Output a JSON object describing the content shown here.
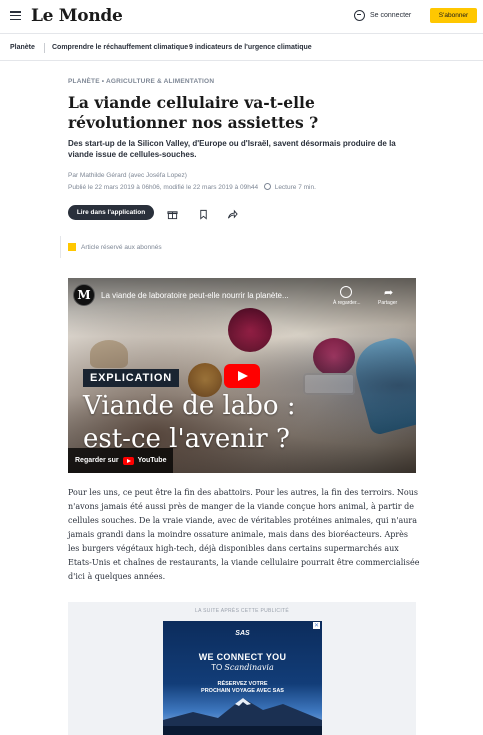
{
  "header": {
    "logo": "Le Monde",
    "login_label": "Se connecter",
    "subscribe_label": "S'abonner"
  },
  "nav": {
    "items": [
      "Planète",
      "Comprendre le réchauffement climatique",
      "9 indicateurs de l'urgence climatique"
    ]
  },
  "article": {
    "kicker": "PLANÈTE  •  AGRICULTURE & ALIMENTATION",
    "title": "La viande cellulaire va-t-elle révolutionner nos assiettes ?",
    "lead": "Des start-up de la Silicon Valley, d'Europe ou d'Israël, savent désormais produire de la viande issue de cellules-souches.",
    "author": "Par Mathilde Gérard (avec Joséfa Lopez)",
    "dates": "Publié le 22 mars 2019 à 06h06, modifié le 22 mars 2019 à 09h44",
    "reading_time": "Lecture 7 min.",
    "app_button": "Lire dans l'application",
    "reserved": "Article réservé aux abonnés",
    "body": "Pour les uns, ce peut être la fin des abattoirs. Pour les autres, la fin des terroirs. Nous n'avons jamais été aussi près de manger de la viande conçue hors animal, à partir de cellules souches. De la vraie viande, avec de véritables protéines animales, qui n'aura jamais grandi dans la moindre ossature animale, mais dans des bioréacteurs. Après les burgers végétaux high-tech, déjà disponibles dans certains supermarchés aux Etats-Unis et chaînes de restaurants, la viande cellulaire pourrait être commercialisée d'ici à quelques années."
  },
  "video": {
    "channel_logo": "M",
    "title": "La viande de laboratoire peut-elle nourrir la planète...",
    "later_label": "À regarder...",
    "share_label": "Partager",
    "badge": "EXPLICATION",
    "headline_line1": "Viande de labo :",
    "headline_line2": "est-ce l'avenir ?",
    "watch_on": "Regarder sur",
    "platform": "YouTube"
  },
  "ad": {
    "label": "LA SUITE APRÈS CETTE PUBLICITÉ",
    "brand": "SAS",
    "headline1": "WE CONNECT YOU",
    "headline2_prefix": "TO ",
    "headline2_italic": "Scandinavia",
    "sub1": "RÉSERVEZ VOTRE",
    "sub2": "PROCHAIN VOYAGE AVEC SAS",
    "close": "✕"
  }
}
